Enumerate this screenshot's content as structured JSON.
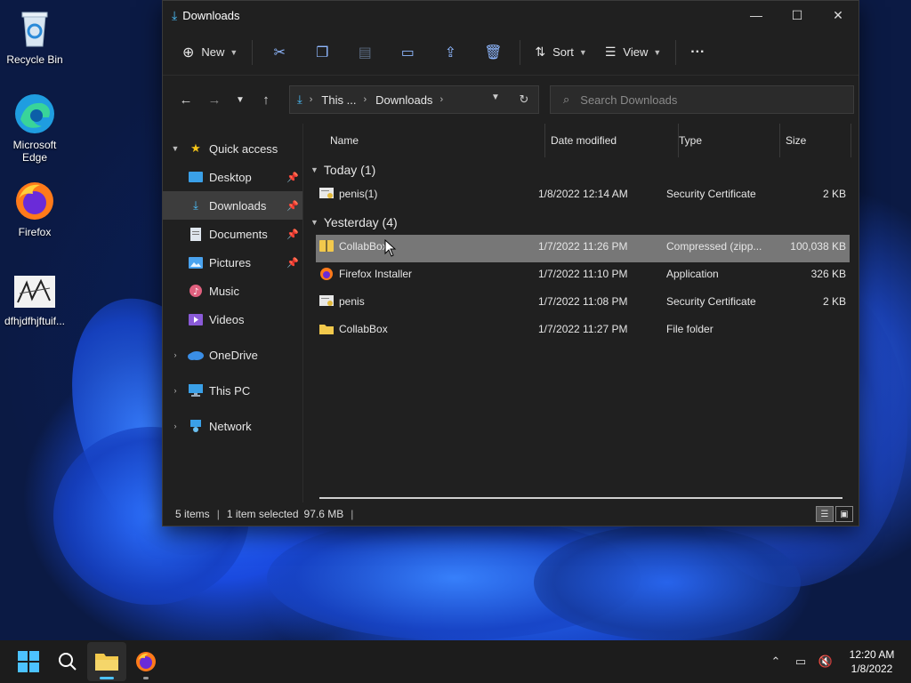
{
  "desktop": {
    "icons": [
      {
        "label": "Recycle Bin"
      },
      {
        "label": "Microsoft Edge"
      },
      {
        "label": "Firefox"
      },
      {
        "label": "dfhjdfhjftuif..."
      }
    ]
  },
  "window": {
    "title": "Downloads",
    "controls": {
      "minimize": "—",
      "maximize": "☐",
      "close": "✕"
    },
    "toolbar": {
      "new_label": "New",
      "sort_label": "Sort",
      "view_label": "View",
      "more_label": "···"
    },
    "address": {
      "crumb_root": "This ...",
      "crumb_current": "Downloads"
    },
    "search": {
      "placeholder": "Search Downloads"
    },
    "navpane": {
      "quick_access": "Quick access",
      "items": [
        {
          "label": "Desktop"
        },
        {
          "label": "Downloads"
        },
        {
          "label": "Documents"
        },
        {
          "label": "Pictures"
        },
        {
          "label": "Music"
        },
        {
          "label": "Videos"
        }
      ],
      "onedrive": "OneDrive",
      "thispc": "This PC",
      "network": "Network"
    },
    "columns": {
      "name": "Name",
      "date": "Date modified",
      "type": "Type",
      "size": "Size"
    },
    "groups": {
      "today": "Today (1)",
      "yesterday": "Yesterday (4)"
    },
    "files": {
      "today": [
        {
          "name": "penis(1)",
          "date": "1/8/2022 12:14 AM",
          "type": "Security Certificate",
          "size": "2 KB"
        }
      ],
      "yesterday": [
        {
          "name": "CollabBox",
          "date": "1/7/2022 11:26 PM",
          "type": "Compressed (zipp...",
          "size": "100,038 KB"
        },
        {
          "name": "Firefox Installer",
          "date": "1/7/2022 11:10 PM",
          "type": "Application",
          "size": "326 KB"
        },
        {
          "name": "penis",
          "date": "1/7/2022 11:08 PM",
          "type": "Security Certificate",
          "size": "2 KB"
        },
        {
          "name": "CollabBox",
          "date": "1/7/2022 11:27 PM",
          "type": "File folder",
          "size": ""
        }
      ]
    },
    "status": {
      "items": "5 items",
      "selected": "1 item selected",
      "size": "97.6 MB"
    }
  },
  "taskbar": {
    "clock_time": "12:20 AM",
    "clock_date": "1/8/2022"
  },
  "colors": {
    "accent": "#4cc2ff",
    "window_bg": "#202020",
    "selected_row": "#777777",
    "folder": "#f2c94c"
  }
}
